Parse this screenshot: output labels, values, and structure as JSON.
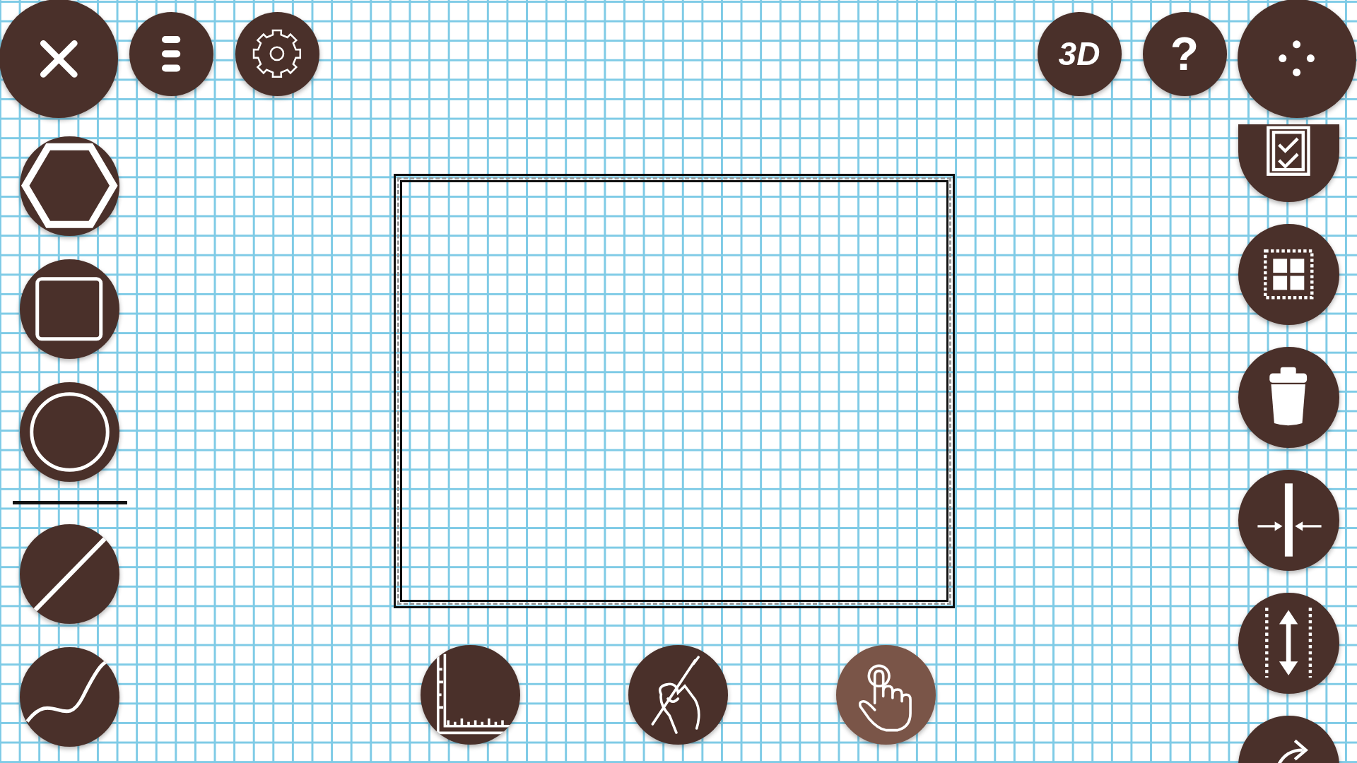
{
  "top_left": [
    {
      "kind": "close"
    },
    {
      "kind": "menu"
    },
    {
      "kind": "settings"
    }
  ],
  "top_right": [
    {
      "kind": "text",
      "label": "3D"
    },
    {
      "kind": "text",
      "label": "?"
    },
    {
      "kind": "dots"
    }
  ],
  "left_tools": [
    {
      "kind": "hexagon"
    },
    {
      "kind": "square"
    },
    {
      "kind": "circle"
    },
    {
      "kind": "line"
    },
    {
      "kind": "curve"
    }
  ],
  "right_tools": [
    {
      "kind": "clipboard"
    },
    {
      "kind": "grid"
    },
    {
      "kind": "trash"
    },
    {
      "kind": "split"
    },
    {
      "kind": "height"
    },
    {
      "kind": "redo"
    }
  ],
  "bottom_tools": [
    {
      "kind": "ruler",
      "selected": false
    },
    {
      "kind": "pen",
      "selected": false
    },
    {
      "kind": "touch",
      "selected": true
    }
  ]
}
